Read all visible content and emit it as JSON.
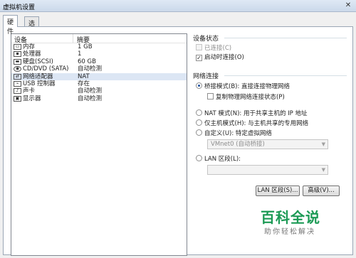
{
  "window": {
    "title": "虚拟机设置"
  },
  "tabs": [
    {
      "label": "硬件"
    },
    {
      "label": "选项"
    }
  ],
  "device_list": {
    "columns": [
      "设备",
      "摘要"
    ],
    "rows": [
      {
        "icon": "memory-icon",
        "name": "内存",
        "summary": "1 GB"
      },
      {
        "icon": "cpu-icon",
        "name": "处理器",
        "summary": "1"
      },
      {
        "icon": "harddisk-icon",
        "name": "硬盘(SCSI)",
        "summary": "60 GB"
      },
      {
        "icon": "cdrom-icon",
        "name": "CD/DVD (SATA)",
        "summary": "自动检测"
      },
      {
        "icon": "network-icon",
        "name": "网络适配器",
        "summary": "NAT"
      },
      {
        "icon": "usb-icon",
        "name": "USB 控制器",
        "summary": "存在"
      },
      {
        "icon": "sound-icon",
        "name": "声卡",
        "summary": "自动检测"
      },
      {
        "icon": "display-icon",
        "name": "显示器",
        "summary": "自动检测"
      }
    ]
  },
  "device_status": {
    "title": "设备状态",
    "connected_label": "已连接(C)",
    "connect_on_start_label": "启动时连接(O)"
  },
  "network": {
    "title": "网络连接",
    "bridged_label": "桥接模式(B): 直接连接物理网络",
    "replicate_label": "复制物理网络连接状态(P)",
    "nat_label": "NAT 模式(N): 用于共享主机的 IP 地址",
    "hostonly_label": "仅主机模式(H): 与主机共享的专用网络",
    "custom_label": "自定义(U): 特定虚拟网络",
    "vmnet_value": "VMnet0 (自动桥接)",
    "lan_label": "LAN 区段(L):",
    "lan_value": ""
  },
  "buttons": {
    "lan_segment": "LAN 区段(S)...",
    "advanced": "高级(V)..."
  },
  "watermark": {
    "title": "百科全说",
    "subtitle": "助你轻松解决"
  }
}
